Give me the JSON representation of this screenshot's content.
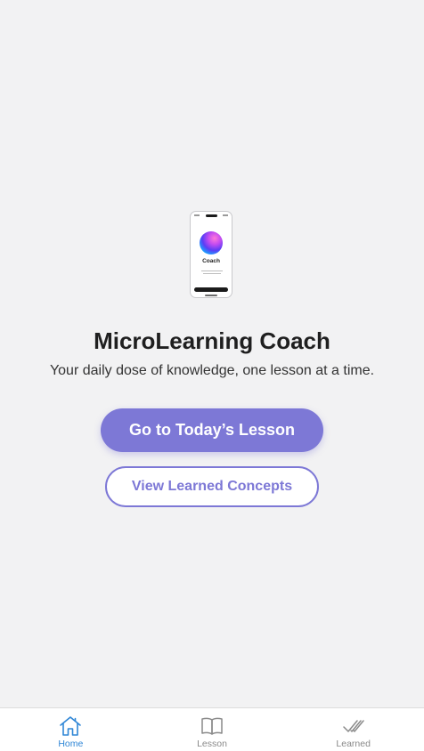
{
  "hero": {
    "title": "MicroLearning Coach",
    "subtitle": "Your daily dose of knowledge, one lesson at a time.",
    "illustration_app_name": "Coach"
  },
  "actions": {
    "primary_label": "Go to Today’s Lesson",
    "secondary_label": "View Learned Concepts"
  },
  "tabs": [
    {
      "label": "Home",
      "icon": "home-icon",
      "active": true
    },
    {
      "label": "Lesson",
      "icon": "book-icon",
      "active": false
    },
    {
      "label": "Learned",
      "icon": "double-check-icon",
      "active": false
    }
  ],
  "colors": {
    "background": "#f2f2f3",
    "accent": "#7d78d6",
    "tab_active": "#2f86d6",
    "tab_inactive": "#8a8a8a"
  }
}
